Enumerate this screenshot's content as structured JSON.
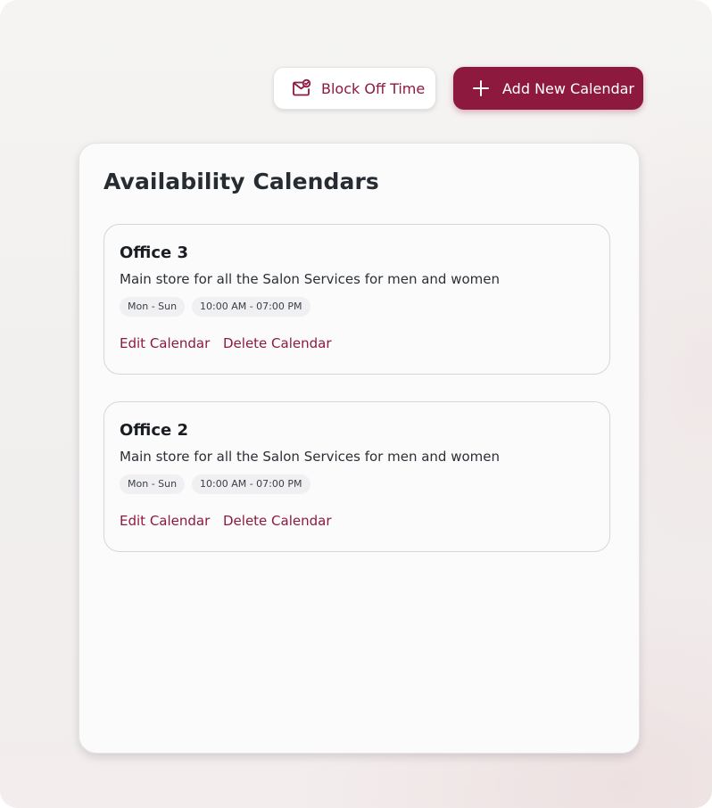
{
  "toolbar": {
    "block_off_time": {
      "label": "Block Off Time",
      "icon": "mail-check-icon"
    },
    "add_new_calendar": {
      "label": "Add New Calendar",
      "icon": "plus-icon"
    }
  },
  "colors": {
    "accent": "#8d1a3e",
    "panel_background": "#fbfbfb",
    "page_background": "#f3f2f1",
    "chip_background": "#f0f0f3"
  },
  "panel": {
    "title": "Availability Calendars",
    "calendars": [
      {
        "name": "Office 3",
        "description": "Main store for all the Salon Services for men and women",
        "days": "Mon - Sun",
        "hours": "10:00 AM - 07:00 PM",
        "edit_label": "Edit Calendar",
        "delete_label": "Delete Calendar"
      },
      {
        "name": "Office 2",
        "description": "Main store for all the Salon Services for men and women",
        "days": "Mon - Sun",
        "hours": "10:00 AM - 07:00 PM",
        "edit_label": "Edit Calendar",
        "delete_label": "Delete Calendar"
      }
    ]
  }
}
